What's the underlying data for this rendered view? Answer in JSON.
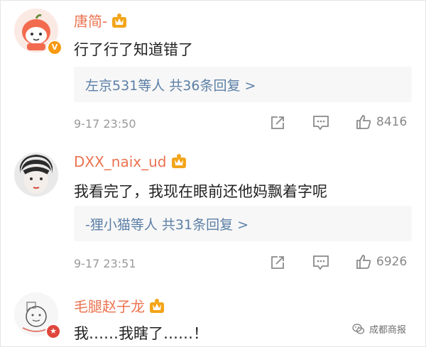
{
  "comments": [
    {
      "username": "唐简-",
      "avatar_icon": "cartoon-character-avatar",
      "verified_badge": "V",
      "text": "行了行了知道错了",
      "reply_summary": "左京531等人  共36条回复 >",
      "time": "9-17 23:50",
      "like_count": "8416"
    },
    {
      "username": "DXX_naix_ud",
      "avatar_icon": "face-photo-avatar",
      "text": "我看完了，我现在眼前还他妈飘着字呢",
      "reply_summary": "-狸小猫等人  共31条回复 >",
      "time": "9-17 23:51",
      "like_count": "6926"
    },
    {
      "username": "毛腿赵子龙",
      "avatar_icon": "doodle-avatar",
      "text": "我……我瞎了……！"
    }
  ],
  "watermark": {
    "label": "成都商报",
    "icon": "wechat-icon"
  },
  "colors": {
    "username": "#eb7350",
    "link": "#5b7fa6",
    "crown": "#f2a51a",
    "badge_orange": "#f79a12",
    "badge_red": "#e0463c"
  }
}
